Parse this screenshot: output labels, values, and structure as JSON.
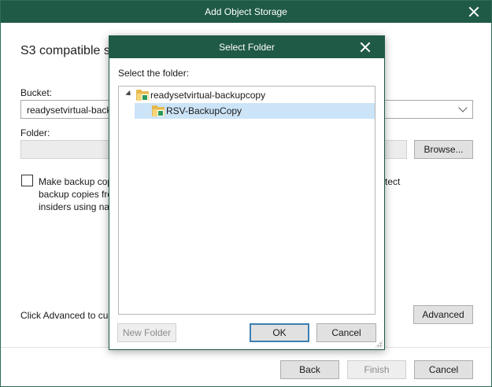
{
  "window": {
    "title": "Add Object Storage",
    "heading": "S3 compatible st",
    "bucket_label": "Bucket:",
    "bucket_value": "readysetvirtual-back",
    "folder_label": "Folder:",
    "folder_value": "",
    "browse_label": "Browse...",
    "checkbox_text_left": [
      "Make backup cop",
      "backup copies fro",
      "insiders using nat"
    ],
    "checkbox_text_right": "tect",
    "advanced_hint": "Click Advanced to cu",
    "advanced_label": "Advanced",
    "back_label": "Back",
    "finish_label": "Finish",
    "cancel_label": "Cancel"
  },
  "dialog": {
    "title": "Select Folder",
    "prompt": "Select the folder:",
    "tree": [
      {
        "label": "readysetvirtual-backupcopy",
        "level": 0,
        "expanded": true,
        "selected": false
      },
      {
        "label": "RSV-BackupCopy",
        "level": 1,
        "expanded": false,
        "selected": true
      }
    ],
    "new_folder_label": "New Folder",
    "ok_label": "OK",
    "cancel_label": "Cancel"
  },
  "colors": {
    "titlebar": "#1f5a46",
    "selection": "#cce4f7",
    "folder": "#e8b850"
  }
}
